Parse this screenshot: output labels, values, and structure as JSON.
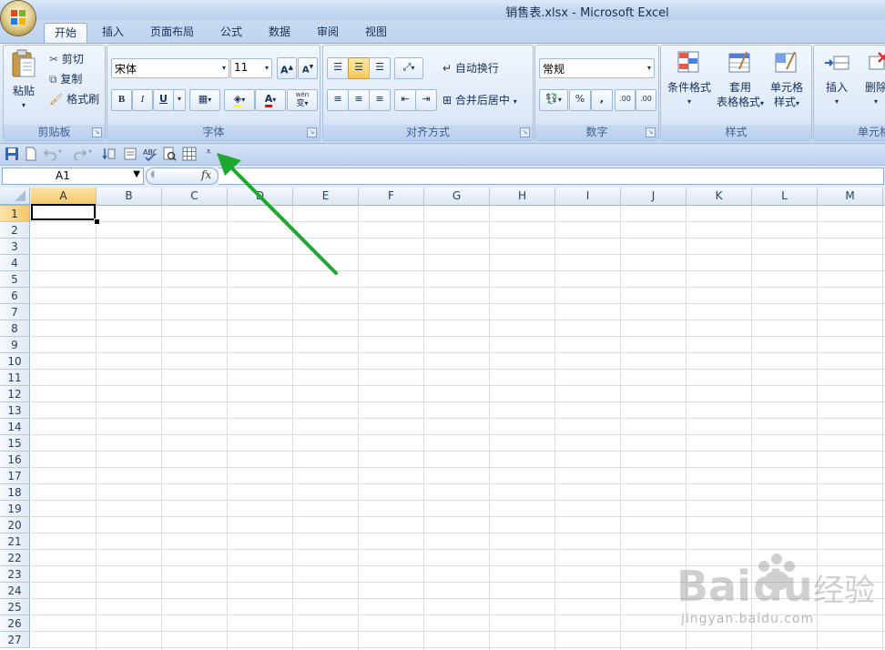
{
  "window": {
    "title": "销售表.xlsx - Microsoft Excel"
  },
  "tabs": [
    "开始",
    "插入",
    "页面布局",
    "公式",
    "数据",
    "审阅",
    "视图"
  ],
  "active_tab": "开始",
  "clipboard": {
    "paste": "粘贴",
    "cut": "剪切",
    "copy": "复制",
    "format_painter": "格式刷",
    "label": "剪贴板"
  },
  "font": {
    "name": "宋体",
    "size": "11",
    "label": "字体",
    "bold": "B",
    "italic": "I",
    "underline": "U",
    "phonetic": "wén",
    "phonetic_char": "变"
  },
  "alignment": {
    "wrap": "自动换行",
    "merge": "合并后居中",
    "label": "对齐方式"
  },
  "number": {
    "format": "常规",
    "percent": "%",
    "comma": ",",
    "inc_decimal": ".00",
    "dec_decimal": ".00",
    "label": "数字"
  },
  "styles": {
    "conditional": "条件格式",
    "table_line1": "套用",
    "table_line2": "表格格式",
    "cell_line1": "单元格",
    "cell_line2": "样式",
    "label": "样式"
  },
  "cells": {
    "insert": "插入",
    "delete": "删除",
    "label": "单元格"
  },
  "formula_bar": {
    "name_box": "A1",
    "fx": "fx",
    "value": ""
  },
  "columns": [
    "A",
    "B",
    "C",
    "D",
    "E",
    "F",
    "G",
    "H",
    "I",
    "J",
    "K",
    "L",
    "M"
  ],
  "rows": [
    "1",
    "2",
    "3",
    "4",
    "5",
    "6",
    "7",
    "8",
    "9",
    "10",
    "11",
    "12",
    "13",
    "14",
    "15",
    "16",
    "17",
    "18",
    "19",
    "20",
    "21",
    "22",
    "23",
    "24",
    "25",
    "26",
    "27"
  ],
  "selected_cell": "A1",
  "watermark": {
    "brand": "Baidu",
    "brand_cn": "经验",
    "url": "jingyan.baidu.com"
  },
  "colors": {
    "accent_tab": "#ffffff",
    "annotation_arrow": "#1fa82e",
    "selection_header": "#f5c766"
  }
}
